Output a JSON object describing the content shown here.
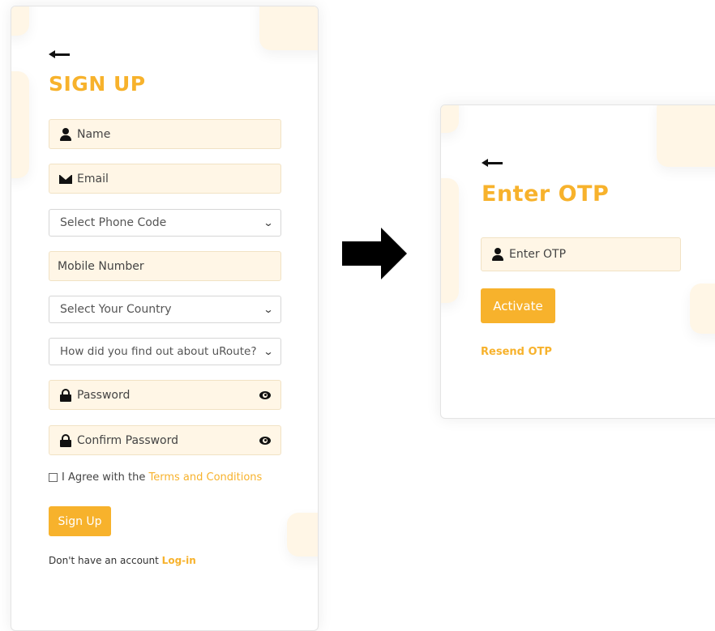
{
  "signup": {
    "title": "SIGN UP",
    "fields": {
      "name": "Name",
      "email": "Email",
      "phone_code": "Select Phone Code",
      "mobile": "Mobile Number",
      "country": "Select Your Country",
      "source": "How did you find out about uRoute?",
      "password": "Password",
      "confirm_password": "Confirm Password"
    },
    "agree_prefix": "I Agree with the",
    "terms_link": "Terms and Conditions",
    "submit_label": "Sign Up",
    "login_prompt": "Don't have an account",
    "login_link": "Log-in"
  },
  "otp": {
    "title": "Enter OTP",
    "placeholder": "Enter OTP",
    "activate_label": "Activate",
    "resend_link": "Resend OTP"
  },
  "icons": [
    "back-arrow-icon",
    "user-icon",
    "mail-icon",
    "chevron-down-icon",
    "lock-icon",
    "eye-icon",
    "right-arrow-icon"
  ],
  "colors": {
    "accent": "#f7b22c",
    "field_bg": "#fff6e6",
    "text": "#333333"
  }
}
